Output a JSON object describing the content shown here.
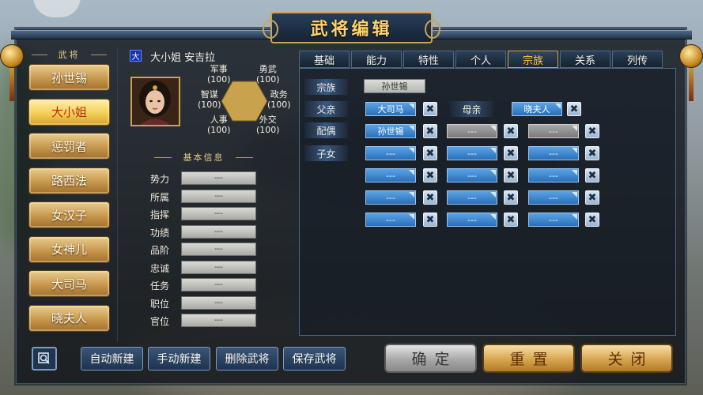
{
  "window": {
    "title": "武将编辑"
  },
  "officer_list": {
    "header": "武将",
    "items": [
      {
        "label": "孙世锡",
        "selected": false
      },
      {
        "label": "大小姐",
        "selected": true
      },
      {
        "label": "惩罚者",
        "selected": false
      },
      {
        "label": "路西法",
        "selected": false
      },
      {
        "label": "女汉子",
        "selected": false
      },
      {
        "label": "女神儿",
        "selected": false
      },
      {
        "label": "大司马",
        "selected": false
      },
      {
        "label": "晓夫人",
        "selected": false
      }
    ]
  },
  "character": {
    "faction_badge": "大",
    "name": "大小姐  安吉拉",
    "stats": {
      "military": {
        "label": "军事",
        "value": "(100)"
      },
      "valor": {
        "label": "勇武",
        "value": "(100)"
      },
      "strategy": {
        "label": "智谋",
        "value": "(100)"
      },
      "politics": {
        "label": "政务",
        "value": "(100)"
      },
      "personnel": {
        "label": "人事",
        "value": "(100)"
      },
      "diplomacy": {
        "label": "外交",
        "value": "(100)"
      }
    }
  },
  "basic_info": {
    "header": "基本信息",
    "rows": [
      {
        "label": "势力",
        "value": "---"
      },
      {
        "label": "所属",
        "value": "---"
      },
      {
        "label": "指挥",
        "value": "---"
      },
      {
        "label": "功绩",
        "value": "---"
      },
      {
        "label": "品阶",
        "value": "---"
      },
      {
        "label": "忠诚",
        "value": "---"
      },
      {
        "label": "任务",
        "value": "---"
      },
      {
        "label": "职位",
        "value": "---"
      },
      {
        "label": "官位",
        "value": "---"
      }
    ]
  },
  "tabs": [
    {
      "label": "基础",
      "active": false
    },
    {
      "label": "能力",
      "active": false
    },
    {
      "label": "特性",
      "active": false
    },
    {
      "label": "个人",
      "active": false
    },
    {
      "label": "宗族",
      "active": true
    },
    {
      "label": "关系",
      "active": false
    },
    {
      "label": "列传",
      "active": false
    }
  ],
  "clan": {
    "clan_label": "宗族",
    "clan_value": "孙世锡",
    "father_label": "父亲",
    "father_value": "大司马",
    "mother_label": "母亲",
    "mother_value": "晓夫人",
    "spouse_label": "配偶",
    "spouses": [
      "孙世锡",
      "---",
      "---"
    ],
    "children_label": "子女",
    "children": [
      "---",
      "---",
      "---",
      "---",
      "---",
      "---",
      "---",
      "---",
      "---",
      "---",
      "---",
      "---"
    ],
    "remove_symbol": "✖"
  },
  "bottom_bar": {
    "auto_create": "自动新建",
    "manual_create": "手动新建",
    "delete_officer": "删除武将",
    "save_officer": "保存武将",
    "confirm": "确定",
    "reset": "重置",
    "close": "关闭"
  },
  "colors": {
    "accent_gold": "#ffc93c",
    "selected_text": "#c0290a",
    "slot_blue": "#2a6fb8"
  }
}
